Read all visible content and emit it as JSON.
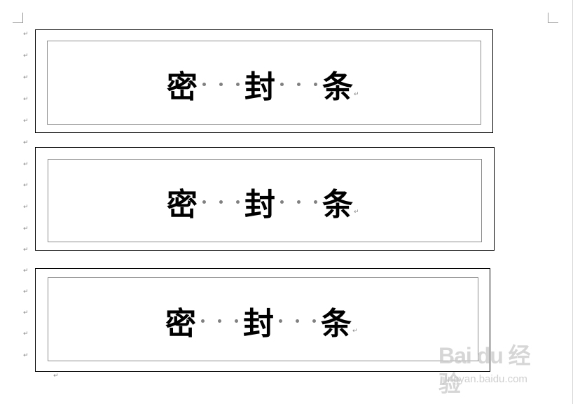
{
  "document": {
    "paragraph_mark": "↵",
    "seals": [
      {
        "text": [
          "密",
          "封",
          "条"
        ],
        "paragraph_mark": "↵"
      },
      {
        "text": [
          "密",
          "封",
          "条"
        ],
        "paragraph_mark": "↵"
      },
      {
        "text": [
          "密",
          "封",
          "条"
        ],
        "paragraph_mark": "↵"
      }
    ],
    "dot_color": "#808080"
  },
  "watermark": {
    "logo_text": "Bai du 经验",
    "url": "jingyan.baidu.com"
  }
}
